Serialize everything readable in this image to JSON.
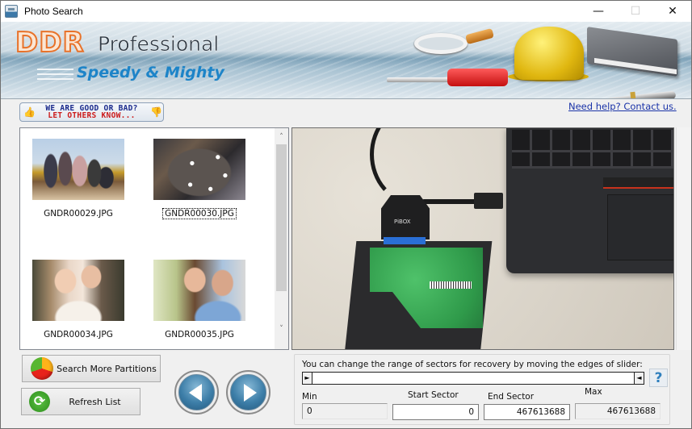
{
  "window": {
    "title": "Photo Search",
    "controls": {
      "minimize": "—",
      "maximize": "☐",
      "close": "✕"
    }
  },
  "banner": {
    "brand": "DDR",
    "product": "Professional",
    "tagline": "Speedy & Mighty",
    "illustrations": [
      "magnifier",
      "screwdriver",
      "hard-hat",
      "book",
      "fountain-pen"
    ]
  },
  "feedback": {
    "line1": "WE ARE GOOD OR BAD?",
    "line2": "LET OTHERS KNOW...",
    "thumb_up": "👍",
    "thumb_down": "👎"
  },
  "help_link": "Need help? Contact us.",
  "thumbnails": [
    {
      "filename": "GNDR00029.JPG",
      "focused": false,
      "scene": "group of friends celebrating"
    },
    {
      "filename": "GNDR00030.JPG",
      "focused": true,
      "scene": "people around a table with coffee"
    },
    {
      "filename": "GNDR00034.JPG",
      "focused": false,
      "scene": "two women smiling"
    },
    {
      "filename": "GNDR00035.JPG",
      "focused": false,
      "scene": "smiling couple hugging"
    }
  ],
  "scrollbar": {
    "up": "˄",
    "down": "˅"
  },
  "preview": {
    "scene": "hard drive connected to laptop via SATA-USB adapter",
    "adapter_label": "PiBOX"
  },
  "buttons": {
    "search_more": "Search More Partitions",
    "refresh": "Refresh List",
    "refresh_glyph": "⟳"
  },
  "sector_range": {
    "hint": "You can change the range of sectors for recovery by moving the edges of slider:",
    "slider_left_glyph": "►",
    "slider_right_glyph": "◄",
    "help_glyph": "?",
    "min_label": "Min",
    "min_value": "0",
    "start_label": "Start Sector",
    "start_value": "0",
    "end_label": "End Sector",
    "end_value": "467613688",
    "max_label": "Max",
    "max_value": "467613688"
  },
  "colors": {
    "brand_orange": "#e8722a",
    "tagline_blue": "#1d84c8",
    "link_blue": "#1a33a8",
    "feedback_blue": "#1a2a8c",
    "feedback_red": "#cc1a1a"
  }
}
